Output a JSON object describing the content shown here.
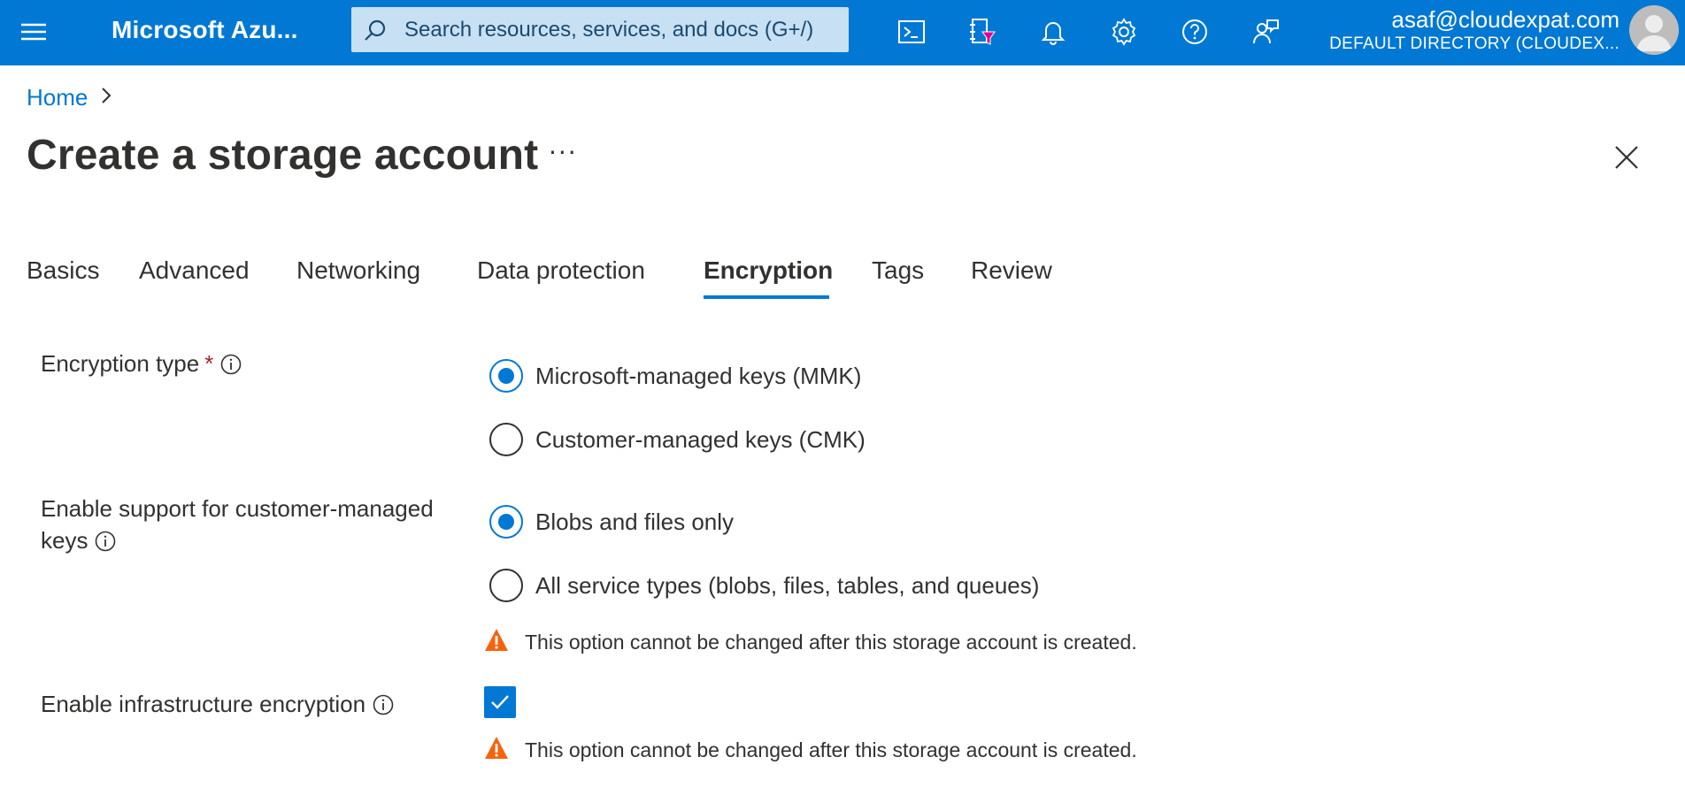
{
  "topbar": {
    "brand": "Microsoft Azu...",
    "search_placeholder": "Search resources, services, and docs (G+/)",
    "icons": [
      "cloud-shell-icon",
      "directory-filter-icon",
      "notifications-icon",
      "settings-icon",
      "help-icon",
      "feedback-icon"
    ],
    "account_email": "asaf@cloudexpat.com",
    "account_directory": "DEFAULT DIRECTORY (CLOUDEX..."
  },
  "breadcrumb": {
    "home": "Home"
  },
  "page": {
    "title": "Create a storage account",
    "more": "···"
  },
  "tabs": [
    {
      "label": "Basics",
      "active": false
    },
    {
      "label": "Advanced",
      "active": false
    },
    {
      "label": "Networking",
      "active": false
    },
    {
      "label": "Data protection",
      "active": false
    },
    {
      "label": "Encryption",
      "active": true
    },
    {
      "label": "Tags",
      "active": false
    },
    {
      "label": "Review",
      "active": false
    }
  ],
  "form": {
    "encryption_type": {
      "label": "Encryption type",
      "required_mark": "*",
      "options": [
        {
          "label": "Microsoft-managed keys (MMK)",
          "selected": true
        },
        {
          "label": "Customer-managed keys (CMK)",
          "selected": false
        }
      ]
    },
    "cmk_support": {
      "label_line1": "Enable support for customer-managed",
      "label_line2": "keys",
      "options": [
        {
          "label": "Blobs and files only",
          "selected": true
        },
        {
          "label": "All service types (blobs, files, tables, and queues)",
          "selected": false
        }
      ],
      "warning": "This option cannot be changed after this storage account is created."
    },
    "infrastructure_encryption": {
      "label": "Enable infrastructure encryption",
      "checked": true,
      "warning": "This option cannot be changed after this storage account is created."
    }
  },
  "colors": {
    "accent": "#0078d4",
    "warning": "#f7630c",
    "required": "#a4262c"
  }
}
